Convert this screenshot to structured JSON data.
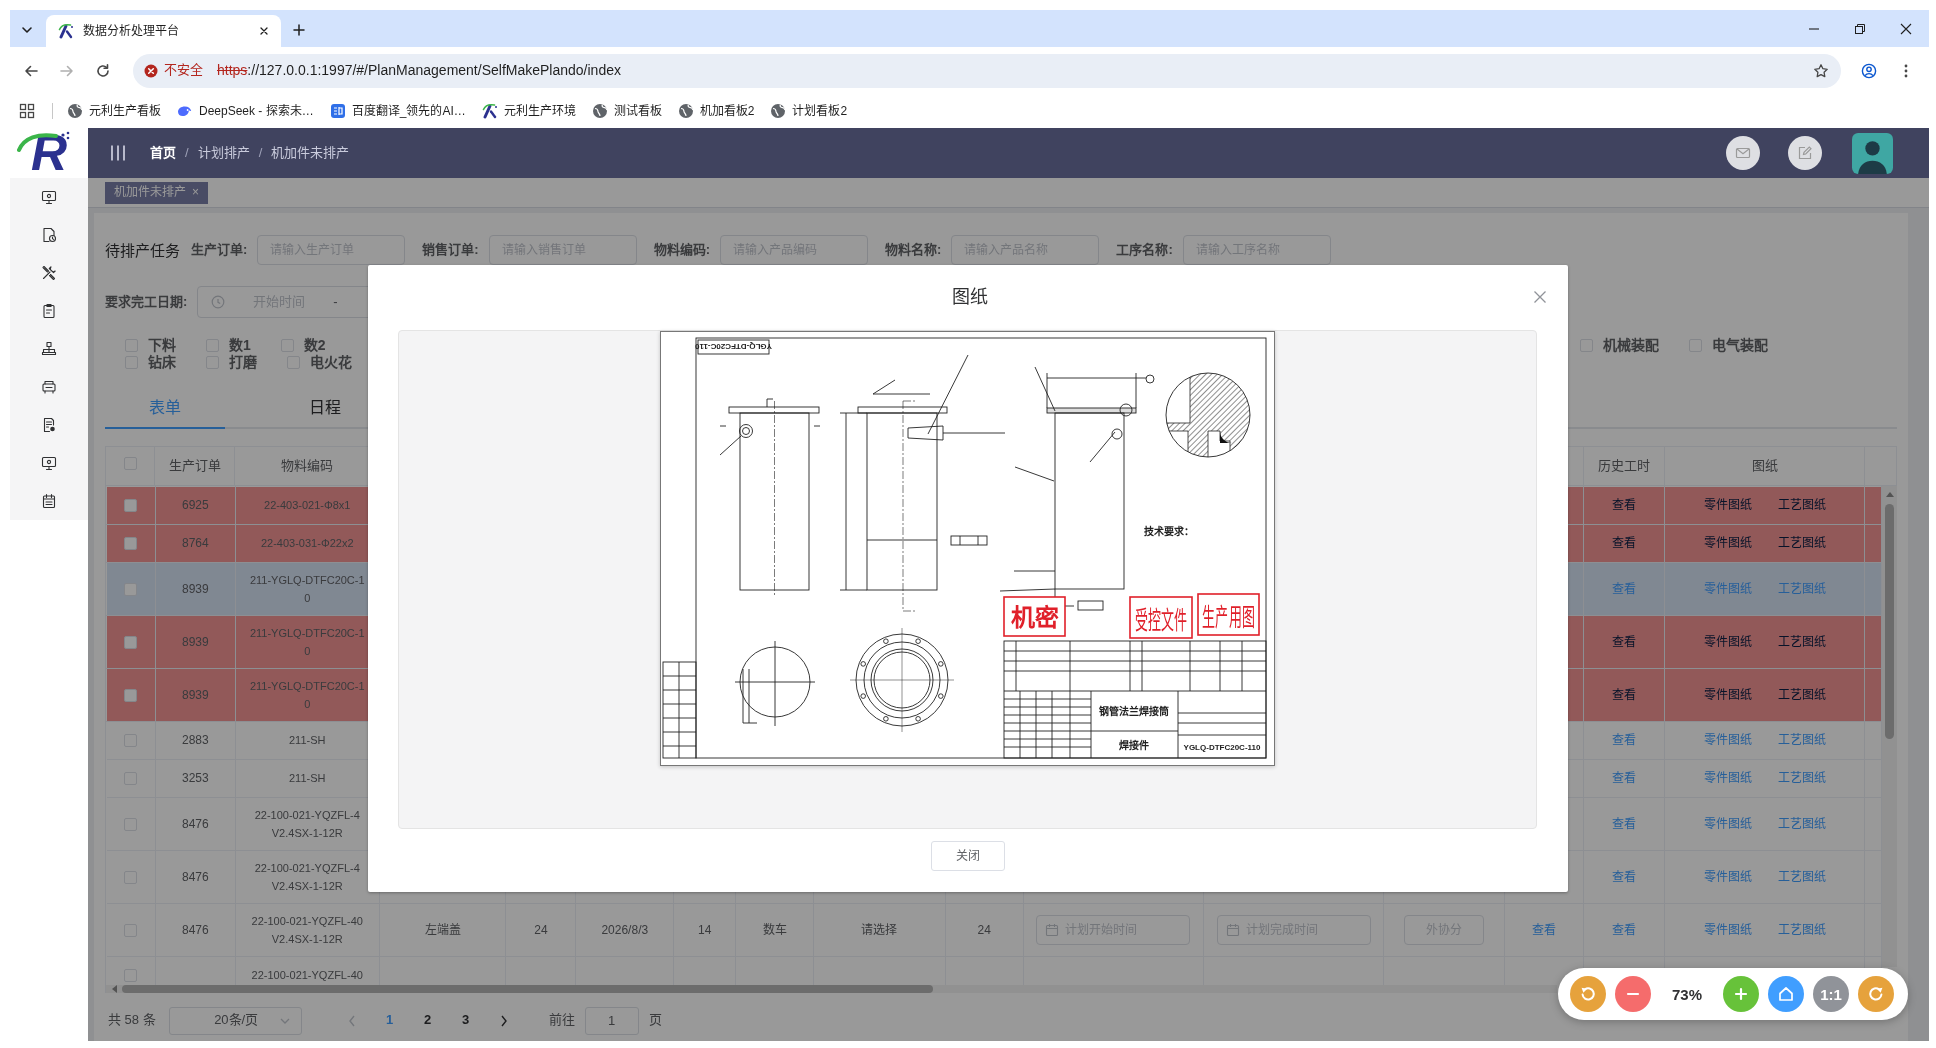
{
  "browser": {
    "tab": {
      "title": "数据分析处理平台",
      "selected": true
    },
    "security": "不安全",
    "url": {
      "scheme": "https",
      "rest": "://127.0.0.1:1997/#/PlanManagement/SelfMakePlando/index"
    },
    "bookmarks": [
      {
        "kind": "globe",
        "label": "元利生产看板"
      },
      {
        "kind": "whale",
        "label": "DeepSeek - 探索未…"
      },
      {
        "kind": "tile",
        "label": "百度翻译_领先的AI…"
      },
      {
        "kind": "logo",
        "label": "元利生产环境"
      },
      {
        "kind": "globe",
        "label": "测试看板"
      },
      {
        "kind": "globe",
        "label": "机加看板2"
      },
      {
        "kind": "globe",
        "label": "计划看板2"
      }
    ]
  },
  "app": {
    "logo": "R",
    "breadcrumb": {
      "separator": "/",
      "items": [
        "首页",
        "计划排产",
        "机加件未排产"
      ]
    },
    "tags": [
      {
        "label": "机加件未排产",
        "close": "×",
        "selected": true
      }
    ],
    "filter": {
      "title": "待排产任务",
      "fields": [
        {
          "label": "生产订单:",
          "placeholder": "请输入生产订单"
        },
        {
          "label": "销售订单:",
          "placeholder": "请输入销售订单"
        },
        {
          "label": "物料编码:",
          "placeholder": "请输入产品编码"
        },
        {
          "label": "物料名称:",
          "placeholder": "请输入产品名称"
        },
        {
          "label": "工序名称:",
          "placeholder": "请输入工序名称"
        }
      ],
      "date_range": {
        "label": "要求完工日期:",
        "start_placeholder": "开始时间",
        "separator": "-"
      },
      "checkbox_rows": [
        [
          {
            "label": "下料",
            "checked": false
          },
          {
            "label": "数1",
            "checked": false
          },
          {
            "label": "数2",
            "checked": false
          }
        ],
        [
          {
            "label": "钻床",
            "checked": false
          },
          {
            "label": "打磨",
            "checked": false
          },
          {
            "label": "电火花",
            "checked": false
          }
        ]
      ],
      "checkbox_row_end": [
        {
          "label": "机械装配",
          "checked": false
        },
        {
          "label": "电气装配",
          "checked": false
        }
      ]
    },
    "tabs": [
      {
        "label": "表单",
        "selected": true
      },
      {
        "label": "日程",
        "selected": false
      }
    ],
    "table": {
      "select_all_checked": false,
      "columns": {
        "order_no": "生产订单",
        "material_code": "物料编码",
        "history_hours": "历史工时",
        "drawings": "图纸"
      },
      "rows": [
        {
          "checked": false,
          "alert": true,
          "selected": false,
          "order_no": "6925",
          "material_code": [
            "22-403-021-Φ8x1"
          ],
          "history_hours": "查看",
          "drawings": [
            "零件图纸",
            "工艺图纸"
          ]
        },
        {
          "checked": false,
          "alert": true,
          "selected": false,
          "order_no": "8764",
          "material_code": [
            "22-403-031-Φ22x2"
          ],
          "history_hours": "查看",
          "drawings": [
            "零件图纸",
            "工艺图纸"
          ]
        },
        {
          "checked": false,
          "alert": false,
          "selected": true,
          "order_no": "8939",
          "material_code": [
            "211-YGLQ-DTFC20C-1",
            "0"
          ],
          "history_hours": "查看",
          "drawings": [
            "零件图纸",
            "工艺图纸"
          ]
        },
        {
          "checked": false,
          "alert": true,
          "selected": false,
          "order_no": "8939",
          "material_code": [
            "211-YGLQ-DTFC20C-1",
            "0"
          ],
          "history_hours": "查看",
          "drawings": [
            "零件图纸",
            "工艺图纸"
          ]
        },
        {
          "checked": false,
          "alert": true,
          "selected": false,
          "order_no": "8939",
          "material_code": [
            "211-YGLQ-DTFC20C-1",
            "0"
          ],
          "history_hours": "查看",
          "drawings": [
            "零件图纸",
            "工艺图纸"
          ]
        },
        {
          "checked": false,
          "alert": false,
          "selected": false,
          "order_no": "2883",
          "material_code": [
            "211-SH"
          ],
          "history_hours": "查看",
          "drawings": [
            "零件图纸",
            "工艺图纸"
          ]
        },
        {
          "checked": false,
          "alert": false,
          "selected": false,
          "order_no": "3253",
          "material_code": [
            "211-SH"
          ],
          "history_hours": "查看",
          "drawings": [
            "零件图纸",
            "工艺图纸"
          ]
        },
        {
          "checked": false,
          "alert": false,
          "selected": false,
          "order_no": "8476",
          "material_code": [
            "22-100-021-YQZFL-4",
            "V2.4SX-1-12R"
          ],
          "history_hours": "查看",
          "drawings": [
            "零件图纸",
            "工艺图纸"
          ]
        },
        {
          "checked": false,
          "alert": false,
          "selected": false,
          "order_no": "8476",
          "material_code": [
            "22-100-021-YQZFL-4",
            "V2.4SX-1-12R"
          ],
          "history_hours": "查看",
          "drawings": [
            "零件图纸",
            "工艺图纸"
          ]
        },
        {
          "checked": false,
          "alert": false,
          "selected": false,
          "order_no": "8476",
          "material_code": [
            "22-100-021-YQZFL-40",
            "V2.4SX-1-12R"
          ],
          "column_4": "左端盖",
          "column_5": "24",
          "column_6": "2026/8/3",
          "column_7": "14",
          "column_8": "数车",
          "column_9": "请选择",
          "column_10": "24",
          "column_11": {
            "placeholder": "计划开始时间"
          },
          "column_12": {
            "placeholder": "计划完成时间"
          },
          "column_13": {
            "label": "外协分",
            "disabled": true
          },
          "column_14": "查看",
          "history_hours": "查看",
          "drawings": [
            "零件图纸",
            "工艺图纸"
          ]
        },
        {
          "checked": false,
          "alert": false,
          "selected": false,
          "material_code": [
            "22-100-021-YQZFL-40"
          ]
        }
      ]
    },
    "pagination": {
      "total": "共 58 条",
      "page_size": "20条/页",
      "pages": [
        {
          "label": "1",
          "selected": true
        },
        {
          "label": "2",
          "selected": false
        },
        {
          "label": "3",
          "selected": false
        }
      ],
      "goto": {
        "label": "前往",
        "value": "1",
        "suffix": "页"
      }
    }
  },
  "dialog": {
    "title": "图纸",
    "drawing": {
      "corner_label": "YGLQ-DTFC20C-110",
      "requirements_heading": "技术要求：",
      "stamps": [
        "机密",
        "受控文件",
        "生产用图"
      ],
      "part_name": "钢管法兰焊接筒",
      "part_type": "焊接件",
      "drawing_number": "YGLQ-DTFC20C-110"
    },
    "close_button": "关闭"
  },
  "viewer_controls": [
    {
      "kind": "rotate_left"
    },
    {
      "kind": "zoom_out"
    },
    {
      "kind": "level",
      "text": "73%"
    },
    {
      "kind": "zoom_in"
    },
    {
      "kind": "reset"
    },
    {
      "kind": "actual_size",
      "text": "1:1"
    },
    {
      "kind": "rotate_right"
    }
  ]
}
